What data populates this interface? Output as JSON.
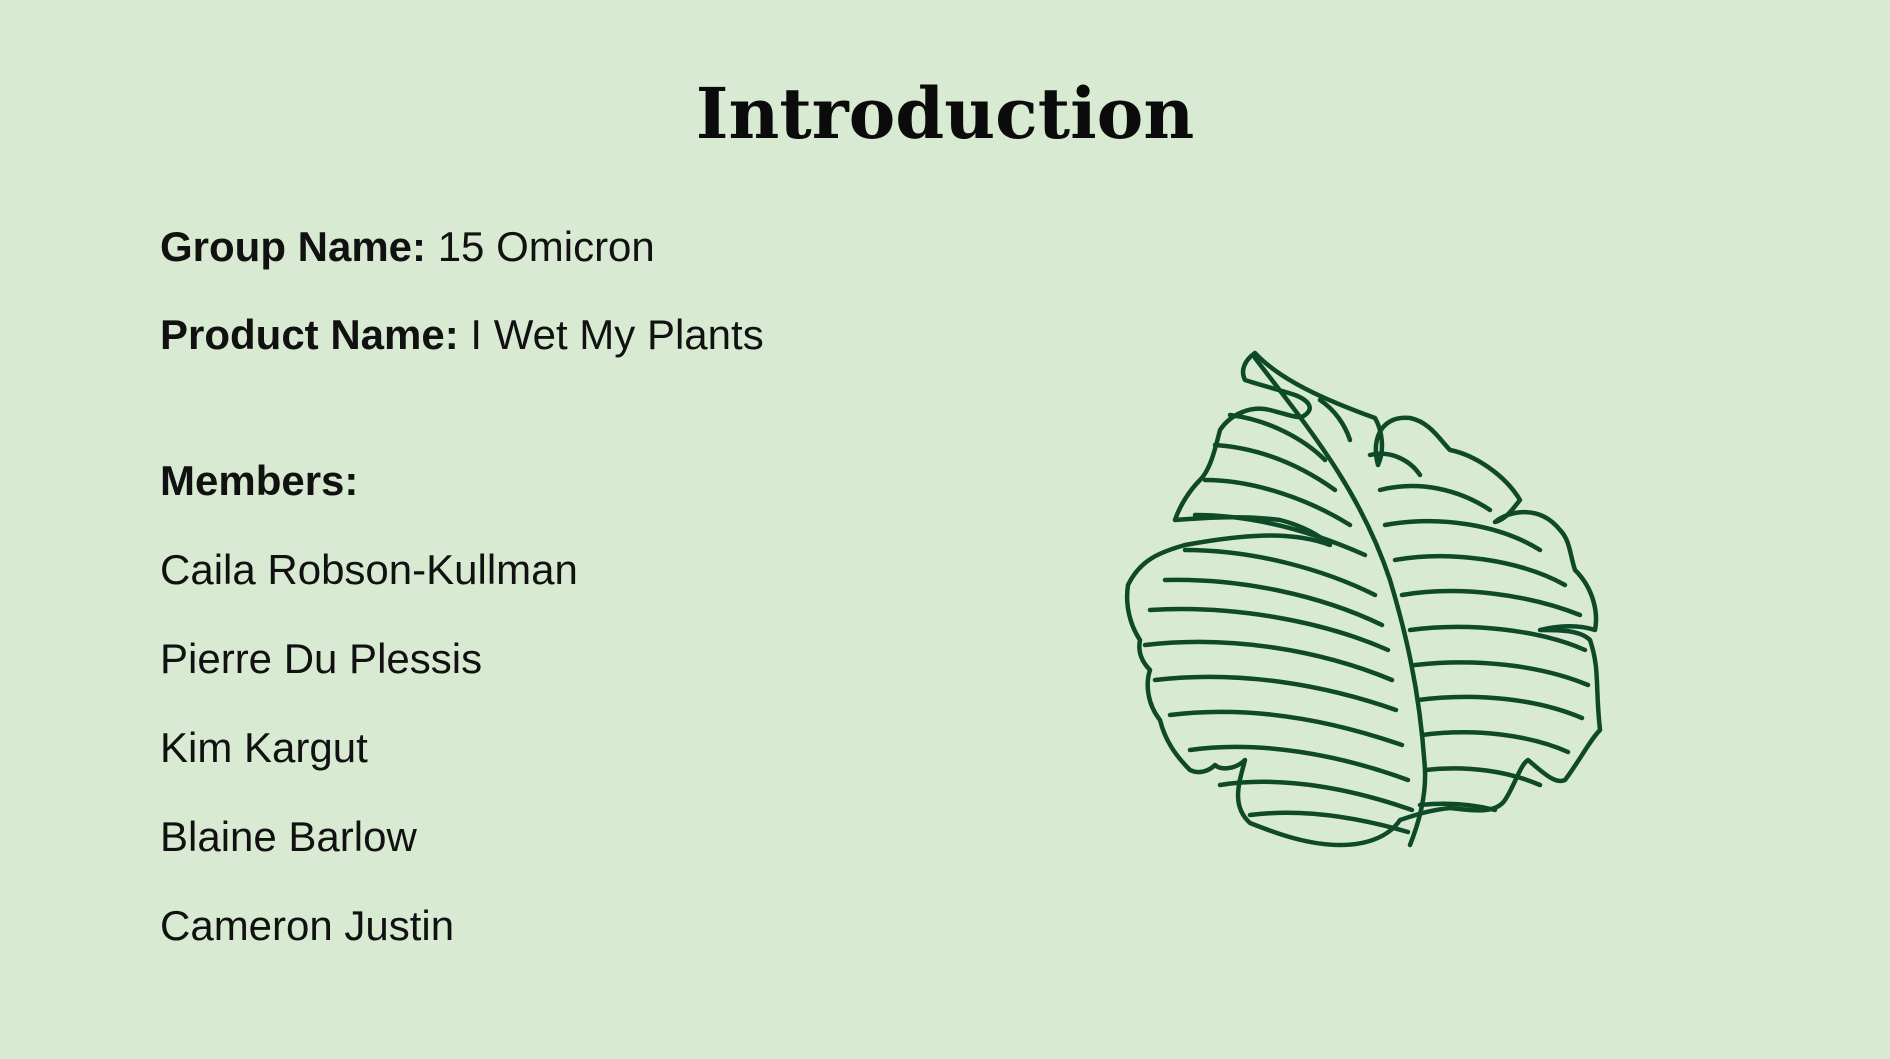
{
  "slide": {
    "title": "Introduction",
    "group": {
      "label": "Group Name:",
      "value": "15 Omicron"
    },
    "product": {
      "label": "Product Name:",
      "value": "I Wet My Plants"
    },
    "members_heading": "Members:",
    "members": [
      "Caila Robson-Kullman",
      "Pierre Du Plessis",
      "Kim Kargut",
      "Blaine Barlow",
      "Cameron Justin"
    ],
    "illustration": "monstera-leaf-icon"
  },
  "colors": {
    "background": "#d9ead3",
    "text": "#111111",
    "leaf_stroke": "#0f4a26"
  }
}
